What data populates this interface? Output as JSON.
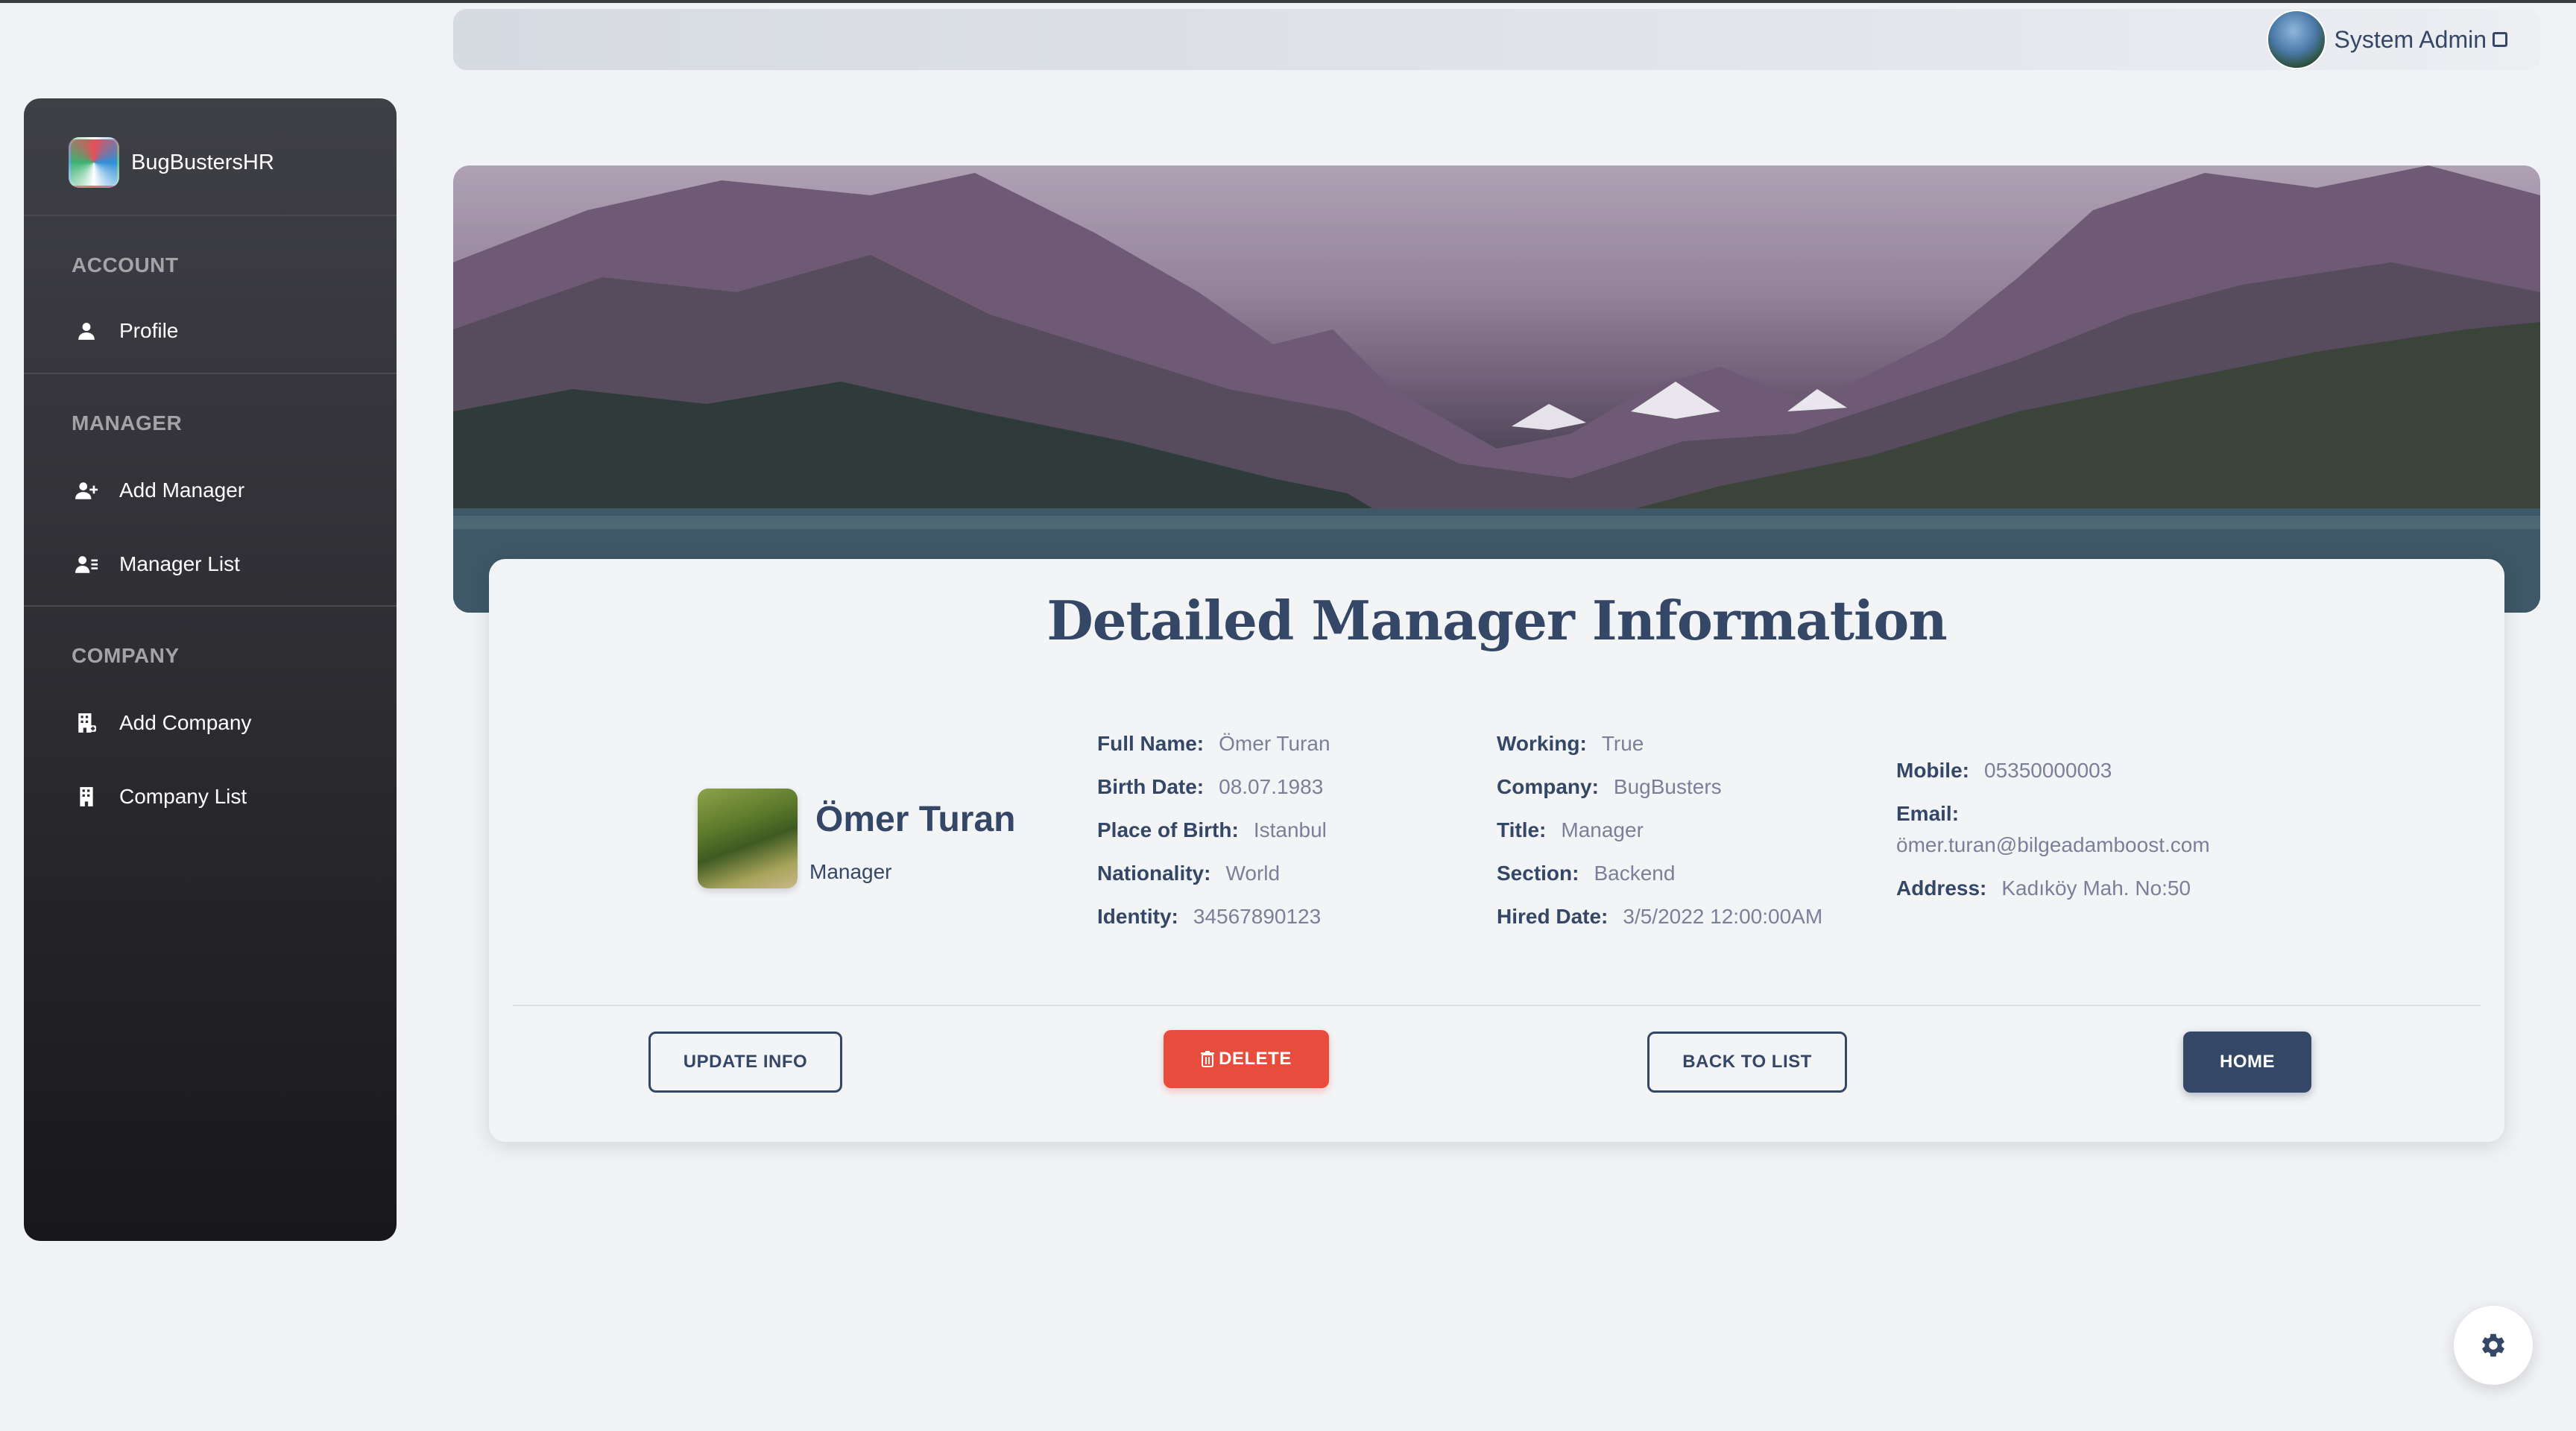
{
  "app": {
    "name": "BugBustersHR"
  },
  "topbar": {
    "user_name": "System Admin"
  },
  "sidebar": {
    "sections": [
      {
        "title": "ACCOUNT",
        "items": [
          {
            "label": "Profile",
            "icon": "user-icon"
          }
        ]
      },
      {
        "title": "MANAGER",
        "items": [
          {
            "label": "Add Manager",
            "icon": "user-plus-icon"
          },
          {
            "label": "Manager List",
            "icon": "user-list-icon"
          }
        ]
      },
      {
        "title": "COMPANY",
        "items": [
          {
            "label": "Add Company",
            "icon": "building-plus-icon"
          },
          {
            "label": "Company List",
            "icon": "building-icon"
          }
        ]
      }
    ]
  },
  "page": {
    "title": "Detailed Manager Information"
  },
  "manager": {
    "name": "Ömer Turan",
    "role": "Manager",
    "col1": [
      {
        "label": "Full Name:",
        "value": "Ömer Turan"
      },
      {
        "label": "Birth Date:",
        "value": "08.07.1983"
      },
      {
        "label": "Place of Birth:",
        "value": "Istanbul"
      },
      {
        "label": "Nationality:",
        "value": "World"
      },
      {
        "label": "Identity:",
        "value": "34567890123"
      }
    ],
    "col2": [
      {
        "label": "Working:",
        "value": "True"
      },
      {
        "label": "Company:",
        "value": "BugBusters"
      },
      {
        "label": "Title:",
        "value": "Manager"
      },
      {
        "label": "Section:",
        "value": "Backend"
      },
      {
        "label": "Hired Date:",
        "value": "3/5/2022 12:00:00AM"
      }
    ],
    "col3": {
      "mobile_label": "Mobile:",
      "mobile": "05350000003",
      "email_label": "Email:",
      "email": "ömer.turan@bilgeadamboost.com",
      "address_label": "Address:",
      "address": "Kadıköy Mah. No:50"
    }
  },
  "actions": {
    "update": "UPDATE INFO",
    "delete": "DELETE",
    "back": "BACK TO LIST",
    "home": "HOME"
  },
  "colors": {
    "primary": "#344767",
    "danger": "#e74c3c",
    "muted": "#7b809a"
  }
}
